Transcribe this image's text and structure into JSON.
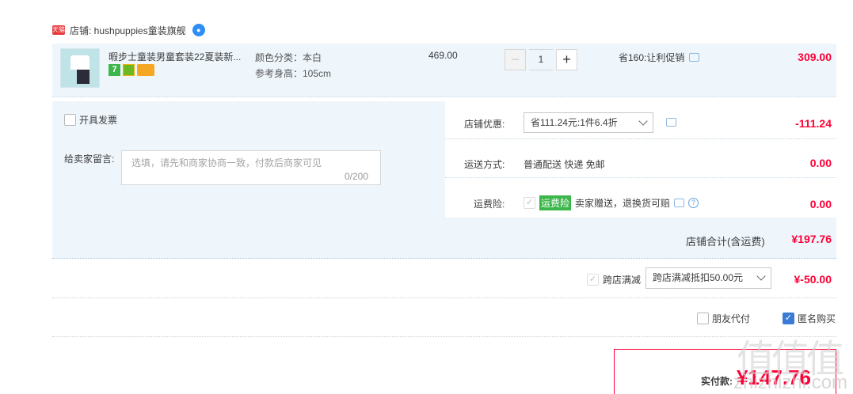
{
  "shop": {
    "badge": "天猫",
    "label": "店铺: hushpuppies童装旗舰",
    "ww_icon": "wangwang-chat-icon"
  },
  "item": {
    "title": "暇步士童装男童套装22夏装新...",
    "sku_color": "颜色分类：本白",
    "sku_height": "参考身高：105cm",
    "price": "469.00",
    "quantity": "1",
    "promo": "省160:让利促销",
    "total": "309.00"
  },
  "invoice": {
    "label": "开具发票"
  },
  "message": {
    "label": "给卖家留言:",
    "placeholder": "选填，请先和商家协商一致，付款后商家可见",
    "count": "0/200"
  },
  "coupon": {
    "label": "店铺优惠:",
    "selected": "省111.24元:1件6.4折",
    "value": "-111.24"
  },
  "shipping": {
    "label": "运送方式:",
    "text": "普通配送 快递 免邮",
    "value": "0.00"
  },
  "insurance": {
    "label": "运费险:",
    "tag": "运费险",
    "text": "卖家赠送，退换货可赔",
    "value": "0.00"
  },
  "subtotal": {
    "label": "店铺合计(含运费)",
    "value": "¥197.76"
  },
  "cross_store": {
    "label": "跨店满减",
    "selected": "跨店满减抵扣50.00元",
    "value": "¥-50.00"
  },
  "options": {
    "friend_pay": "朋友代付",
    "anonymous": "匿名购买"
  },
  "payment": {
    "label": "实付款:",
    "value": "¥147.76"
  },
  "watermark": {
    "text": "值值值",
    "url": "zhizhizhi.com"
  },
  "colors": {
    "accent_red": "#ff0036",
    "panel_blue": "#eef6fc",
    "check_blue": "#3a7bd5",
    "tag_green": "#3cb64a"
  }
}
